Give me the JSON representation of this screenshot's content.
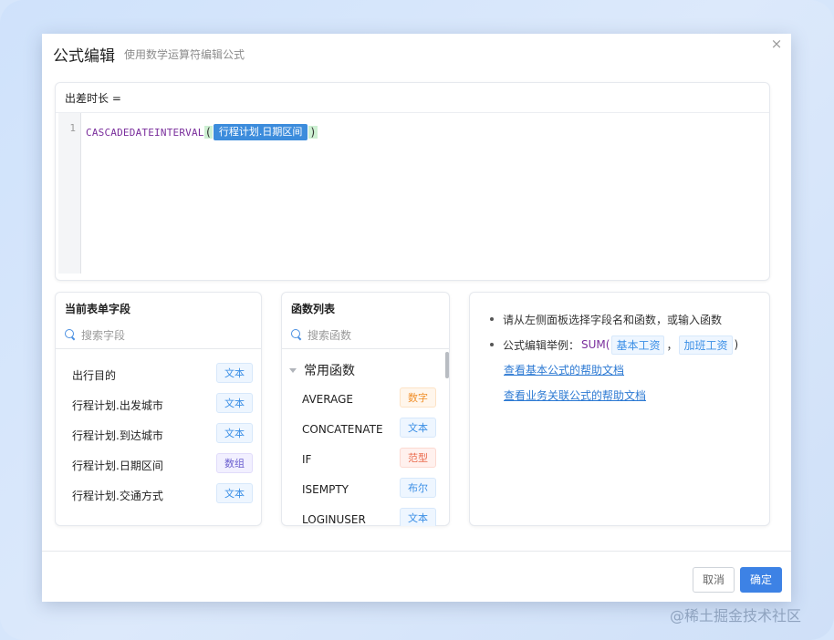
{
  "dialog": {
    "title": "公式编辑",
    "subtitle": "使用数学运算符编辑公式",
    "close_symbol": "×"
  },
  "editor": {
    "label": "出差时长 =",
    "line_number": "1",
    "function_name": "CASCADEDATEINTERVAL",
    "open_paren": "(",
    "field_token": "行程计划.日期区间",
    "close_paren": ")"
  },
  "fields_panel": {
    "title": "当前表单字段",
    "search_placeholder": "搜索字段",
    "items": [
      {
        "label": "出行目的",
        "type": "文本",
        "color": "blue"
      },
      {
        "label": "行程计划.出发城市",
        "type": "文本",
        "color": "blue"
      },
      {
        "label": "行程计划.到达城市",
        "type": "文本",
        "color": "blue"
      },
      {
        "label": "行程计划.日期区间",
        "type": "数组",
        "color": "purple"
      },
      {
        "label": "行程计划.交通方式",
        "type": "文本",
        "color": "blue"
      }
    ]
  },
  "functions_panel": {
    "title": "函数列表",
    "search_placeholder": "搜索函数",
    "group_label": "常用函数",
    "items": [
      {
        "label": "AVERAGE",
        "type": "数字",
        "color": "orange"
      },
      {
        "label": "CONCATENATE",
        "type": "文本",
        "color": "blue"
      },
      {
        "label": "IF",
        "type": "范型",
        "color": "red"
      },
      {
        "label": "ISEMPTY",
        "type": "布尔",
        "color": "blue"
      },
      {
        "label": "LOGINUSER",
        "type": "文本",
        "color": "blue"
      }
    ]
  },
  "help_panel": {
    "tip": "请从左侧面板选择字段名和函数，或输入函数",
    "example_prefix": "公式编辑举例：",
    "example_fn": "SUM(",
    "example_arg1": "基本工资",
    "example_sep": "，",
    "example_arg2": "加班工资",
    "example_close": ")",
    "link_basic": "查看基本公式的帮助文档",
    "link_business": "查看业务关联公式的帮助文档"
  },
  "footer": {
    "cancel_label": "取消",
    "ok_label": "确定"
  },
  "watermark": "@稀土掘金技术社区",
  "colors": {
    "accent": "#3d82e5",
    "token_bg": "#3c8cdc",
    "function_purple": "#7a2e9c",
    "tag_blue": "#3a8ee6",
    "tag_purple": "#6b5fcf",
    "tag_orange": "#f0902c",
    "tag_red": "#ea6a4c"
  }
}
